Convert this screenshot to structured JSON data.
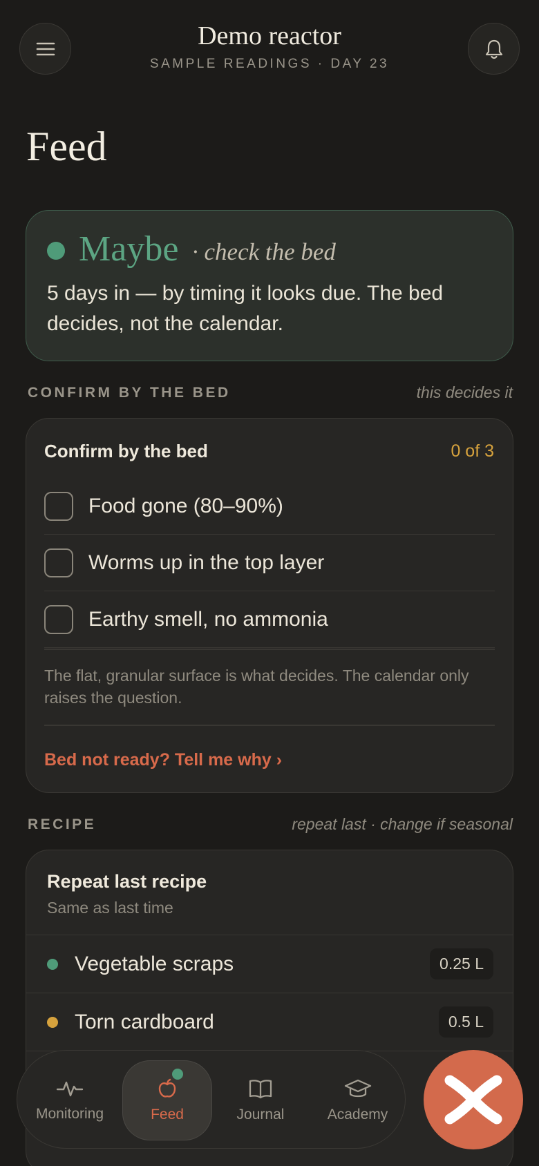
{
  "header": {
    "title": "Demo reactor",
    "subtitle": "SAMPLE READINGS · DAY 23",
    "menu_icon": "menu-icon",
    "bell_icon": "bell-icon"
  },
  "page": {
    "title": "Feed"
  },
  "status": {
    "word": "Maybe",
    "hint": "· check the bed",
    "body": "5 days in — by timing it looks due. The bed decides, not the calendar.",
    "color": "#5ca583"
  },
  "confirm_section": {
    "label": "CONFIRM BY THE BED",
    "note": "this decides it",
    "card_title": "Confirm by the bed",
    "count": "0 of 3",
    "items": [
      {
        "label": "Food gone (80–90%)",
        "checked": false
      },
      {
        "label": "Worms up in the top layer",
        "checked": false
      },
      {
        "label": "Earthy smell, no ammonia",
        "checked": false
      }
    ],
    "footnote": "The flat, granular surface is what decides. The calendar only raises the question.",
    "link": "Bed not ready? Tell me why ›"
  },
  "recipe_section": {
    "label": "RECIPE",
    "note": "repeat last · change if seasonal",
    "card_title": "Repeat last recipe",
    "card_sub": "Same as last time",
    "ingredients": [
      {
        "name": "Vegetable scraps",
        "qty": "0.25 L",
        "color": "#4f9b79"
      },
      {
        "name": "Torn cardboard",
        "qty": "0.5 L",
        "color": "#d6a23d"
      }
    ]
  },
  "nav": {
    "items": [
      {
        "label": "Monitoring",
        "icon": "pulse-icon"
      },
      {
        "label": "Feed",
        "icon": "apple-icon",
        "active": true
      },
      {
        "label": "Journal",
        "icon": "book-icon"
      },
      {
        "label": "Academy",
        "icon": "graduation-cap-icon"
      }
    ]
  },
  "fab": {
    "icon": "close-icon"
  },
  "colors": {
    "background": "#1c1b19",
    "accent": "#d86a4b",
    "green": "#4f9b79",
    "amber": "#d6a23d"
  }
}
